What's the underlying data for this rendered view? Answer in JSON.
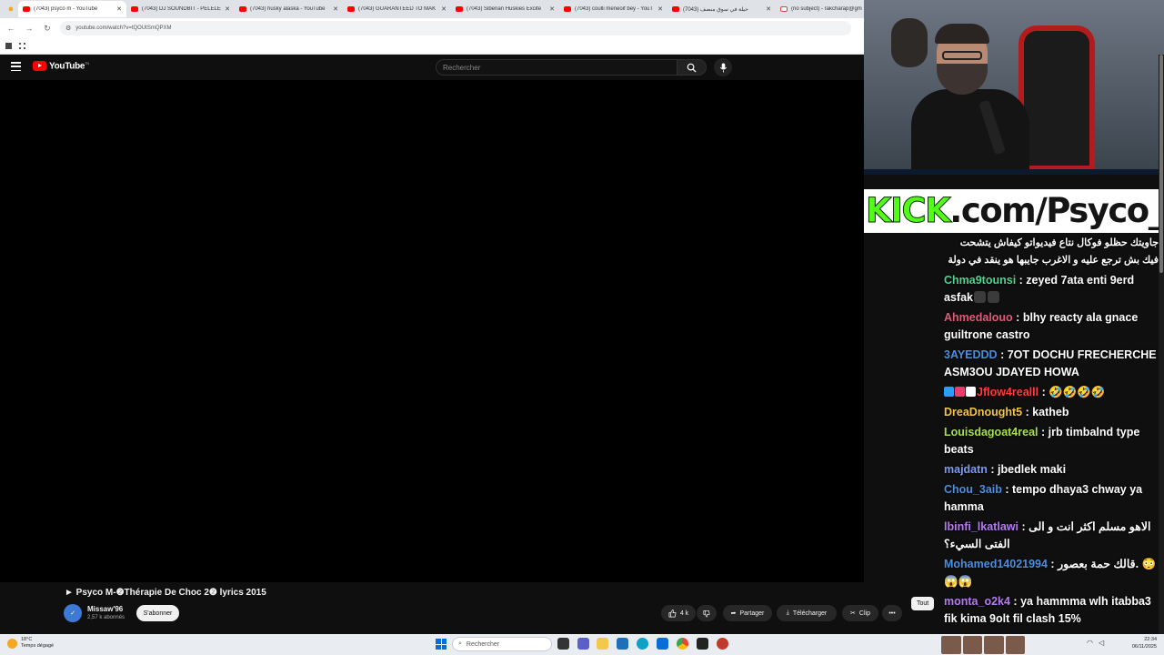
{
  "browser": {
    "tabs": [
      {
        "label": "(7043) psyco m - YouTube",
        "favicon": "youtube-icon",
        "active": true
      },
      {
        "label": "(7043) DJ SOUNDBIT - PELELE",
        "favicon": "youtube-icon",
        "active": false
      },
      {
        "label": "(7043) husky alaska - YouTube",
        "favicon": "youtube-icon",
        "active": false
      },
      {
        "label": "(7043) GUARANTEED TO MAK",
        "favicon": "youtube-icon",
        "active": false
      },
      {
        "label": "(7043) Siberian Huskies Excite",
        "favicon": "youtube-icon",
        "active": false
      },
      {
        "label": "(7043) coulli meneoif bey - YouT",
        "favicon": "youtube-icon",
        "active": false
      },
      {
        "label": "(7043) حيلة في سوق منصف",
        "favicon": "youtube-icon",
        "active": false
      },
      {
        "label": "(no subject) - rakcharap@gm",
        "favicon": "gmail-icon",
        "active": false
      }
    ],
    "url": "youtube.com/watch?v=tQOUtSmQPXM"
  },
  "youtube": {
    "logo_text": "YouTube",
    "logo_sup": "TN",
    "search_placeholder": "Rechercher",
    "video": {
      "title": "► Psyco M-❷Thérapie De Choc 2❷ lyrics 2015",
      "channel_name": "Missaw'96",
      "channel_subs": "2,57 k abonnés",
      "subscribe_label": "S'abonner",
      "like_count": "4 k",
      "share_label": "Partager",
      "download_label": "Télécharger",
      "clip_label": "Clip",
      "more_label": "•••"
    },
    "chip_all": "Tout"
  },
  "stream": {
    "banner": {
      "kick": "KICK",
      "rest": ".com/Psyco_M"
    },
    "chat": [
      {
        "user": "",
        "user_color": "#ffffff",
        "text": "جاويتك حظلو فوكال نتاع فيديواتو كيفاش يتشحت فيك بش ترجع عليه و الاغرب جايبها هو ينقد في دولة",
        "rtl": true,
        "emotes": []
      },
      {
        "user": "Chma9tounsi",
        "user_color": "#4fd28f",
        "text": "zeyed 7ata enti 9erd asfak",
        "emotes": [
          "dark",
          "dark"
        ]
      },
      {
        "user": "Ahmedalouo",
        "user_color": "#e35a7a",
        "text": "blhy reacty ala gnace guiltrone castro",
        "emotes": []
      },
      {
        "user": "3AYEDDD",
        "user_color": "#4a8fe0",
        "text": "7OT DOCHU FRECHERCHE ASM3OU JDAYED HOWA",
        "emotes": []
      },
      {
        "user": "Jflow4realll",
        "user_color": "#ff3b3b",
        "text": "🤣🤣🤣🤣",
        "badges": [
          "#2a9df4",
          "#e5406b",
          "#ffffff"
        ],
        "emotes": []
      },
      {
        "user": "DreaDnought5",
        "user_color": "#f5c542",
        "text": "katheb",
        "emotes": []
      },
      {
        "user": "Louisdagoat4real",
        "user_color": "#a7e04a",
        "text": "jrb timbalnd type beats",
        "emotes": []
      },
      {
        "user": "majdatn",
        "user_color": "#7c9df5",
        "text": "jbedlek maki",
        "emotes": []
      },
      {
        "user": "Chou_3aib",
        "user_color": "#4a8fe0",
        "text": "tempo dhaya3 chway ya hamma",
        "emotes": []
      },
      {
        "user": "lbinfi_lkatlawi",
        "user_color": "#b57cf0",
        "text": "الاهو مسلم اكثر انت و الى الفتى السيء؟",
        "emotes": []
      },
      {
        "user": "Mohamed14021994",
        "user_color": "#4a8fe0",
        "text": "قالك حمة بعصور. 😳😱😱",
        "emotes": []
      },
      {
        "user": "monta_o2k4",
        "user_color": "#b57cf0",
        "text": "ya hammma wlh itabba3 fik kima 9olt fil clash 15%",
        "emotes": []
      }
    ]
  },
  "taskbar": {
    "weather_temp": "18°C",
    "weather_desc": "Temps dégagé",
    "search_placeholder": "Rechercher",
    "time": "22:34",
    "date": "06/11/2025"
  }
}
